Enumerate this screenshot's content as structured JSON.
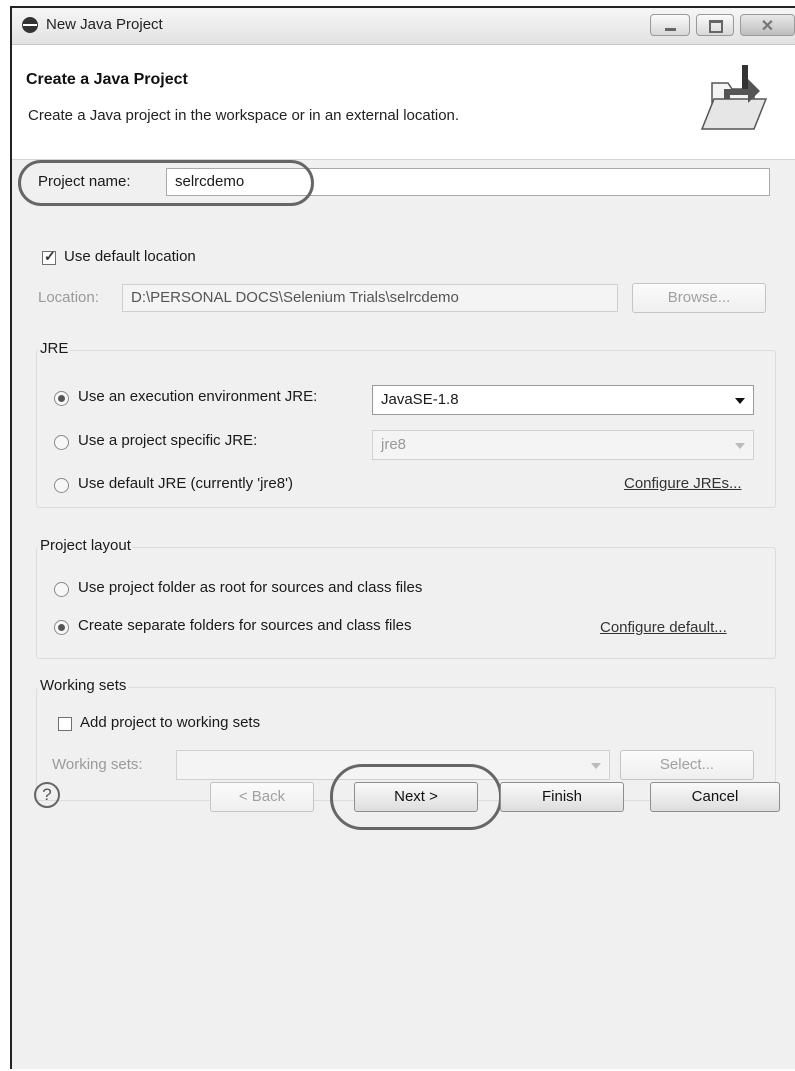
{
  "window": {
    "title": "New Java Project",
    "close_glyph": "✕"
  },
  "header": {
    "title": "Create a Java Project",
    "description": "Create a Java project in the workspace or in an external location."
  },
  "project": {
    "name_label": "Project name:",
    "name_value": "selrcdemo",
    "use_default_location_label": "Use default location",
    "use_default_location_checked": true,
    "location_label": "Location:",
    "location_value": "D:\\PERSONAL DOCS\\Selenium Trials\\selrcdemo",
    "browse_label": "Browse..."
  },
  "jre": {
    "group_label": "JRE",
    "options": [
      {
        "label": "Use an execution environment JRE:",
        "selected": true
      },
      {
        "label": "Use a project specific JRE:",
        "selected": false
      },
      {
        "label": "Use default JRE (currently 'jre8')",
        "selected": false
      }
    ],
    "execution_env_value": "JavaSE-1.8",
    "project_specific_value": "jre8",
    "configure_link": "Configure JREs..."
  },
  "layout": {
    "group_label": "Project layout",
    "options": [
      {
        "label": "Use project folder as root for sources and class files",
        "selected": false
      },
      {
        "label": "Create separate folders for sources and class files",
        "selected": true
      }
    ],
    "configure_link": "Configure default..."
  },
  "working_sets": {
    "group_label": "Working sets",
    "add_label": "Add project to working sets",
    "add_checked": false,
    "sets_label": "Working sets:",
    "sets_value": "",
    "select_label": "Select..."
  },
  "footer": {
    "help_glyph": "?",
    "back_label": "< Back",
    "next_label": "Next >",
    "finish_label": "Finish",
    "cancel_label": "Cancel"
  }
}
